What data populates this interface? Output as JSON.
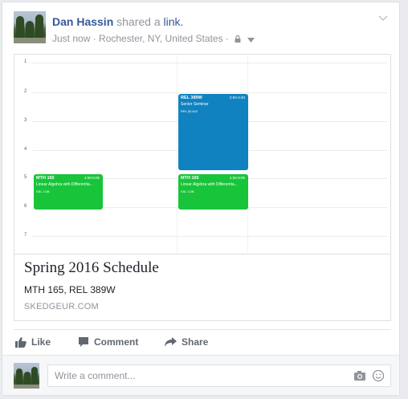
{
  "post": {
    "author": "Dan Hassin",
    "action_text": "shared a",
    "link_word": "link.",
    "timestamp": "Just now",
    "separator": "·",
    "location": "Rochester, NY, United States",
    "separator2": "·"
  },
  "attachment": {
    "calendar": {
      "hour_labels": [
        "1",
        "2",
        "3",
        "4",
        "5",
        "6",
        "7"
      ],
      "events": [
        {
          "code": "REL 389W",
          "time": "2:00-4:40",
          "title": "Senior Seminar",
          "room": "RRL (B-442"
        },
        {
          "code": "MTH 165",
          "time": "4:50-6:05",
          "title": "Linear Algebra with Differentia...",
          "room": "SSL 1OB"
        },
        {
          "code": "MTH 165",
          "time": "4:50-6:05",
          "title": "Linear Algebra with Differentia...",
          "room": "SSL 1OB"
        }
      ]
    },
    "title": "Spring 2016 Schedule",
    "description": "MTH 165, REL 389W",
    "domain": "SKEDGEUR.COM"
  },
  "actions": {
    "like": "Like",
    "comment": "Comment",
    "share": "Share"
  },
  "comment_box": {
    "placeholder": "Write a comment..."
  },
  "icons": {
    "privacy": "lock-icon",
    "audience_dropdown": "caret-down-icon",
    "post_menu": "chevron-down-icon",
    "like": "thumbs-up-icon",
    "comment": "speech-bubble-icon",
    "share": "share-arrow-icon",
    "camera": "camera-icon",
    "emoji": "smiley-icon"
  },
  "colors": {
    "link_blue": "#365899",
    "event_blue": "#1182c0",
    "event_green": "#18c43a"
  }
}
